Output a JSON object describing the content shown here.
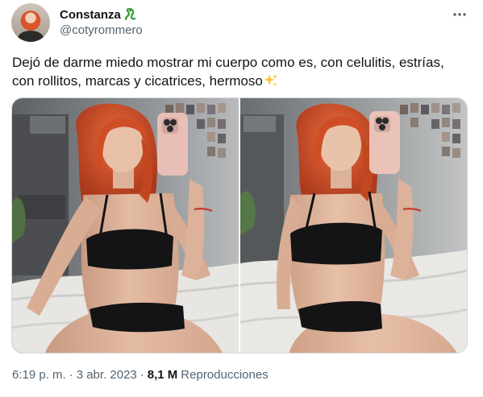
{
  "author": {
    "display_name": "Constanza",
    "handle": "@cotyrommero",
    "name_emoji": "snake-emoji",
    "avatar": "avatar-photo"
  },
  "tweet": {
    "text": "Dejó de darme miedo mostrar mi cuerpo como es, con celulitis, estrías, con rollitos, marcas y cicatrices, hermoso",
    "text_emoji": "sparkles-emoji",
    "more_icon": "more-horizontal-icon"
  },
  "media": {
    "photos": [
      {
        "alt": "mirror-selfie-photo-1"
      },
      {
        "alt": "mirror-selfie-photo-2"
      }
    ]
  },
  "meta": {
    "time": "6:19 p. m.",
    "separator": "·",
    "date": "3 abr. 2023",
    "views_count": "8,1 M",
    "views_label": "Reproducciones"
  },
  "colors": {
    "text_primary": "#0f1419",
    "text_secondary": "#536471",
    "border": "#cfd9de",
    "emoji_green": "#3ea33e",
    "sparkle_yellow": "#f7c72d"
  }
}
